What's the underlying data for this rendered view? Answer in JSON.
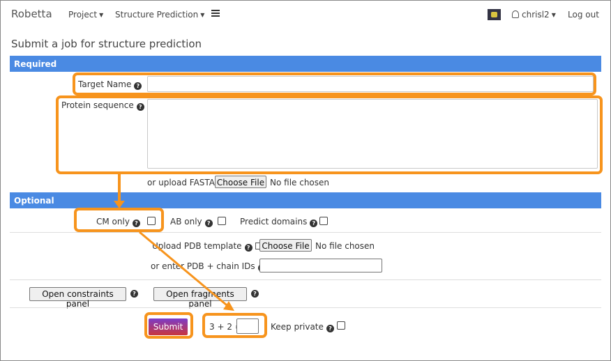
{
  "nav": {
    "brand": "Robetta",
    "project": "Project",
    "structure_prediction": "Structure Prediction",
    "user": "chrisl2",
    "logout": "Log out"
  },
  "page_title": "Submit a job for structure prediction",
  "required": {
    "header": "Required",
    "target_name_label": "Target Name",
    "protein_sequence_label": "Protein sequence",
    "upload_fasta_label": "or upload FASTA",
    "choose_file": "Choose File",
    "no_file": "No file chosen"
  },
  "optional": {
    "header": "Optional",
    "cm_only": "CM only",
    "ab_only": "AB only",
    "predict_domains": "Predict domains",
    "upload_pdb_template": "Upload PDB template",
    "choose_file": "Choose File",
    "no_file": "No file chosen",
    "enter_pdb": "or enter PDB + chain IDs",
    "open_constraints": "Open constraints panel",
    "open_fragments": "Open fragments panel"
  },
  "submit": {
    "label": "Submit",
    "captcha": "3 + 2 =",
    "keep_private": "Keep private"
  },
  "colors": {
    "highlight": "#f7941d",
    "section_bar": "#4a8ae3"
  }
}
